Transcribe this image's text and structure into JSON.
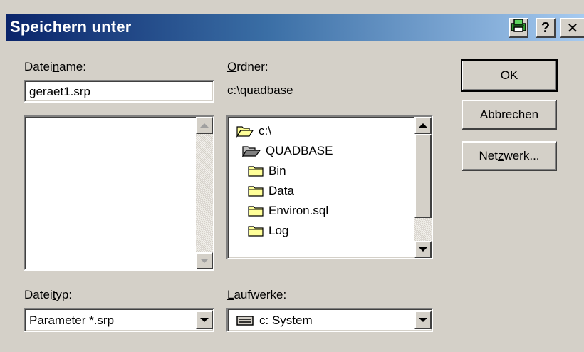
{
  "dialog": {
    "title": "Speichern unter",
    "help_glyph": "?",
    "close_glyph": "✕"
  },
  "filename": {
    "label_pre": "Datei",
    "label_accel": "n",
    "label_post": "ame:",
    "value": "geraet1.srp"
  },
  "folder": {
    "label_accel": "O",
    "label_post": "rdner:",
    "path": "c:\\quadbase",
    "tree": [
      {
        "label": "c:\\",
        "icon": "open-folder-icon"
      },
      {
        "label": "QUADBASE",
        "icon": "open-folder-icon"
      },
      {
        "label": "Bin",
        "icon": "folder-icon"
      },
      {
        "label": "Data",
        "icon": "folder-icon"
      },
      {
        "label": "Environ.sql",
        "icon": "folder-icon"
      },
      {
        "label": "Log",
        "icon": "folder-icon"
      }
    ]
  },
  "filetype": {
    "label_pre": "Datei",
    "label_accel": "t",
    "label_post": "yp:",
    "value": "Parameter *.srp"
  },
  "drives": {
    "label_accel": "L",
    "label_post": "aufwerke:",
    "value": "c: System",
    "icon": "drive-icon"
  },
  "buttons": {
    "ok": "OK",
    "cancel": "Abbrechen",
    "network_pre": "Net",
    "network_accel": "z",
    "network_post": "werk..."
  },
  "colors": {
    "title_start": "#0a246a",
    "title_end": "#a6caf0",
    "face": "#d4d0c8",
    "folder": "#ffff99"
  }
}
